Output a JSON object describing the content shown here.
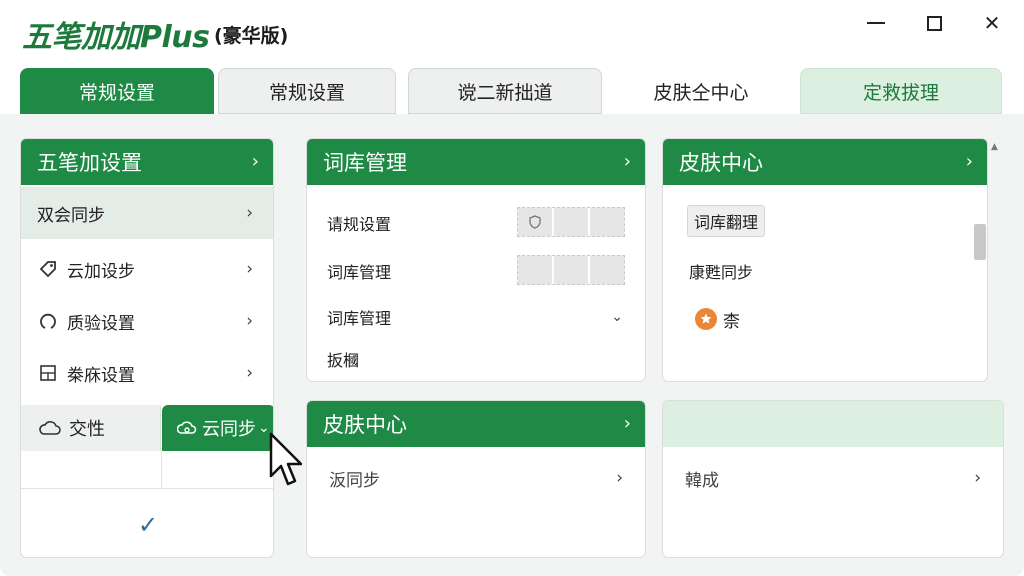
{
  "window": {
    "title": "五笔加加Plus",
    "edition": "(豪华版)",
    "controls": {
      "minimize": "minimize",
      "maximize": "maximize",
      "close": "✕"
    }
  },
  "tabs": [
    {
      "label": "常规设置",
      "state": "active"
    },
    {
      "label": "常规设置",
      "state": "gray"
    },
    {
      "label": "谠二新拙道",
      "state": "gray"
    },
    {
      "label": "皮肤仝中心",
      "state": "plain"
    },
    {
      "label": "定救拔理",
      "state": "light"
    }
  ],
  "left_panel": {
    "title": "五笔加设置",
    "items": [
      {
        "label": "双会同步",
        "icon": "none",
        "selected": true
      },
      {
        "label": "云加设步",
        "icon": "tag-icon"
      },
      {
        "label": "质验设置",
        "icon": "circle-icon"
      },
      {
        "label": "桊庥设置",
        "icon": "grid-icon"
      }
    ],
    "subtabs": {
      "left": {
        "label": "交性",
        "icon": "cloud-icon"
      },
      "right": {
        "label": "云同步",
        "icon": "cloud-sync-icon",
        "caret": "⌄"
      }
    },
    "confirm": "✓"
  },
  "lexicon_panel": {
    "title": "词库管理",
    "rows": [
      {
        "label": "请规设置",
        "control": "placeholder-field",
        "placeholder_glyph": "🛡"
      },
      {
        "label": "词库管理",
        "control": "placeholder-field"
      },
      {
        "label": "词库管理",
        "control": "dropdown",
        "caret": "⌄"
      },
      {
        "label": "扳槶",
        "control": "none"
      }
    ]
  },
  "skin_panel": {
    "title": "皮肤中心",
    "button": "词库翻理",
    "sync_label": "康甦同步",
    "item_label": "柰"
  },
  "skin_panel_2": {
    "title": "皮肤中心",
    "row_label": "汳同步"
  },
  "empty_panel": {
    "row_label": "韓成"
  },
  "colors": {
    "primary": "#1f8a45",
    "light": "#dcefe1",
    "background": "#f1f4f2"
  }
}
